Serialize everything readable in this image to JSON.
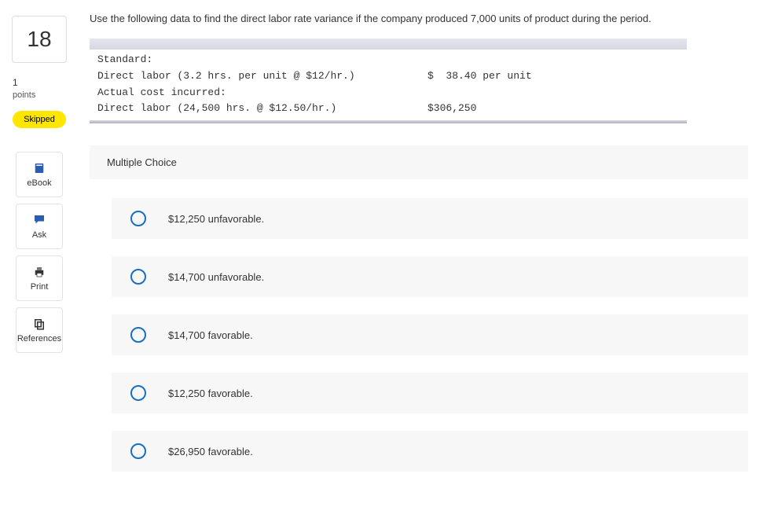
{
  "sidebar": {
    "question_number": "18",
    "points_value": "1",
    "points_label": "points",
    "status": "Skipped",
    "tools": [
      {
        "name": "ebook-button",
        "label": "eBook",
        "icon": "book-icon"
      },
      {
        "name": "ask-button",
        "label": "Ask",
        "icon": "chat-icon"
      },
      {
        "name": "print-button",
        "label": "Print",
        "icon": "printer-icon"
      },
      {
        "name": "references-button",
        "label": "References",
        "icon": "copy-icon"
      }
    ]
  },
  "question": {
    "prompt": "Use the following data to find the direct labor rate variance if the company produced 7,000 units of product during the period.",
    "data_lines": [
      {
        "c1": "Standard:",
        "c2": ""
      },
      {
        "c1": "Direct labor (3.2 hrs. per unit @ $12/hr.)",
        "c2": "$  38.40 per unit"
      },
      {
        "c1": "Actual cost incurred:",
        "c2": ""
      },
      {
        "c1": "Direct labor (24,500 hrs. @ $12.50/hr.)",
        "c2": "$306,250"
      }
    ],
    "mc_label": "Multiple Choice",
    "options": [
      "$12,250 unfavorable.",
      "$14,700 unfavorable.",
      "$14,700 favorable.",
      "$12,250 favorable.",
      "$26,950 favorable."
    ]
  }
}
